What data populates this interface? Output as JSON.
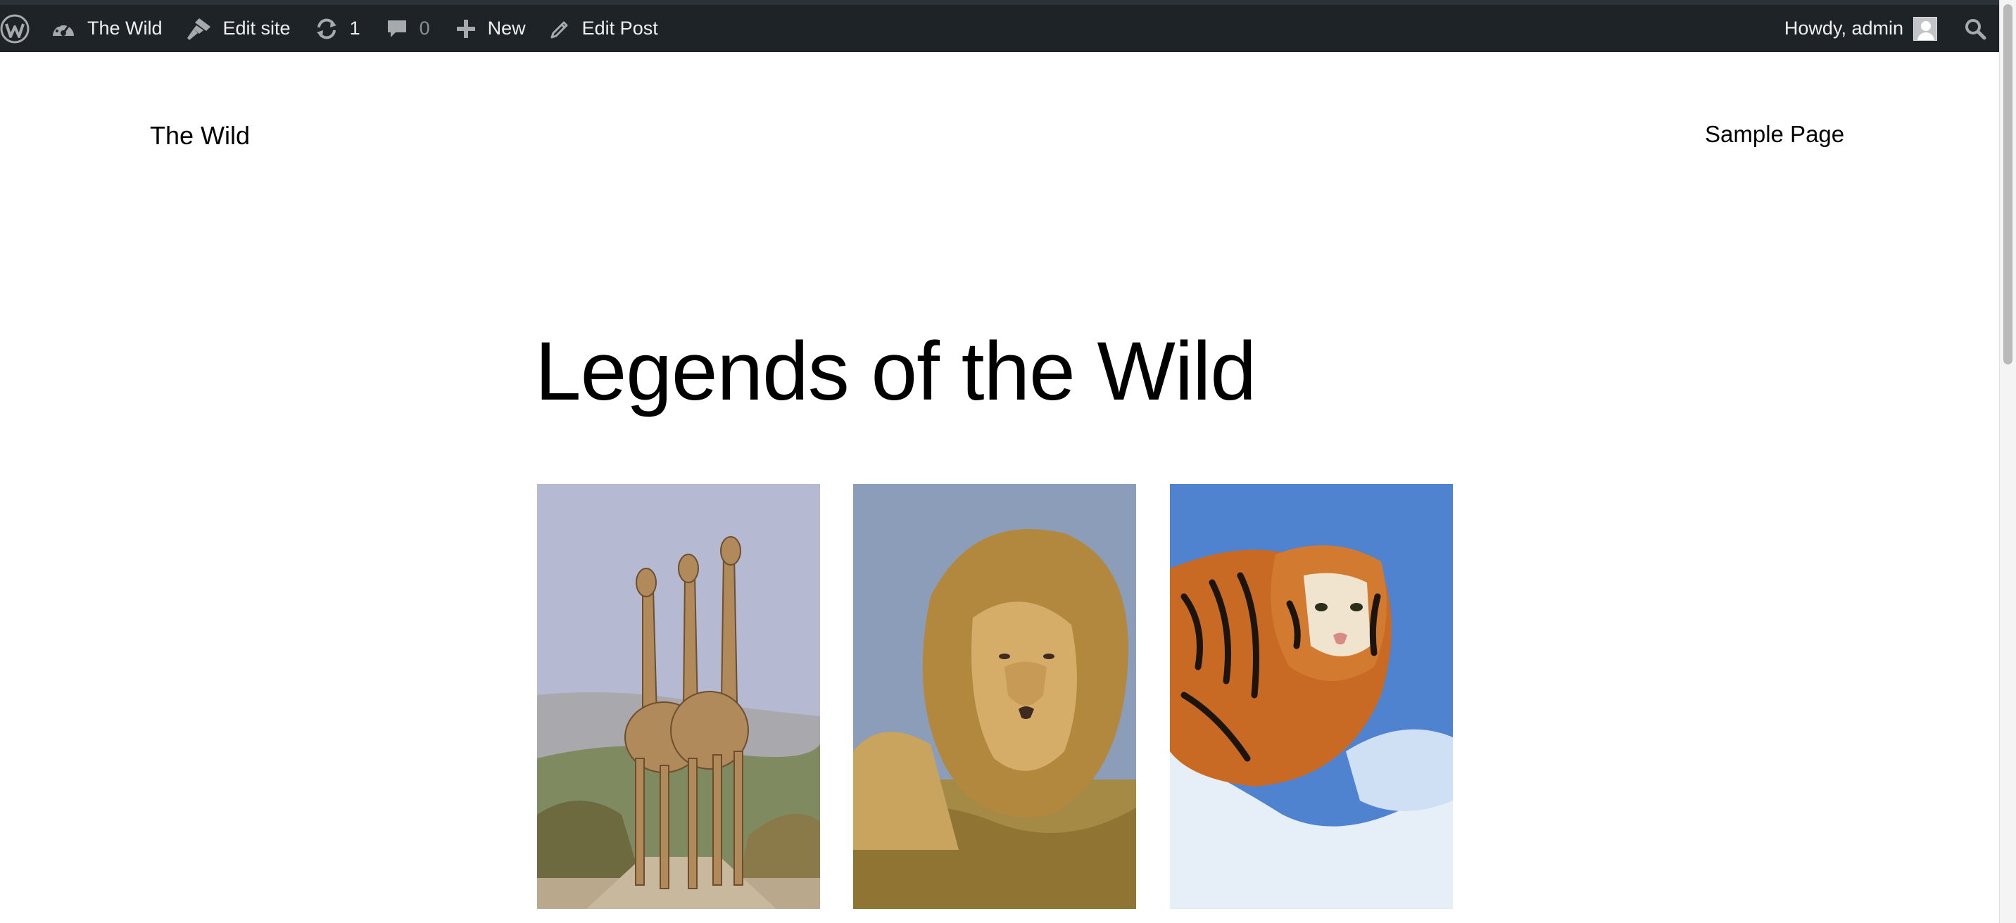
{
  "admin_bar": {
    "wp_logo_icon": "wordpress-logo-icon",
    "site_name": "The Wild",
    "edit_site": "Edit site",
    "updates_count": "1",
    "comments_count": "0",
    "new": "New",
    "edit_post": "Edit Post",
    "howdy": "Howdy, admin",
    "colors": {
      "background": "#1d2327",
      "text": "#f0f0f1",
      "muted": "#8c8f94"
    }
  },
  "site": {
    "title": "The Wild",
    "nav": [
      "Sample Page"
    ]
  },
  "post": {
    "title": "Legends of the Wild",
    "gallery": [
      {
        "subject": "giraffes"
      },
      {
        "subject": "lion"
      },
      {
        "subject": "tiger"
      }
    ]
  }
}
